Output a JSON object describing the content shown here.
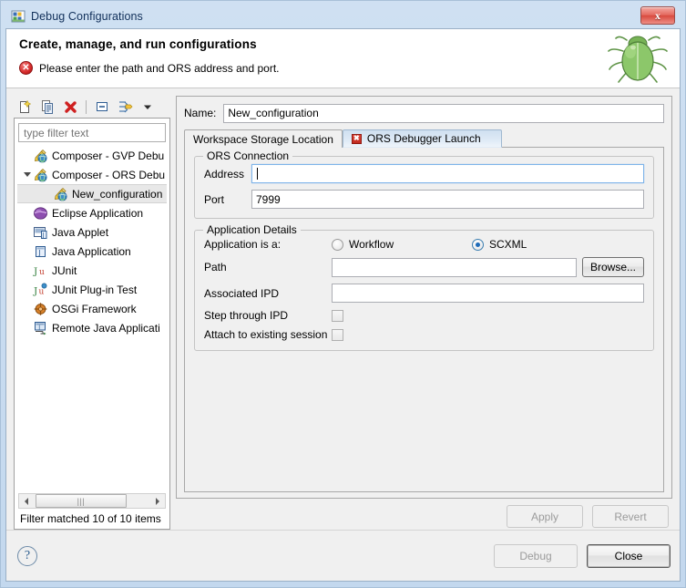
{
  "window": {
    "title": "Debug Configurations",
    "title_icon": "debug-configurations-icon",
    "close_label": "x"
  },
  "banner": {
    "title": "Create, manage, and run configurations",
    "status_icon": "error-icon",
    "status_message": "Please enter the path and ORS address and port.",
    "decoration_icon": "green-bug-icon"
  },
  "tree_toolbar": {
    "buttons": [
      {
        "name": "new-configuration-button",
        "tooltip": "New launch configuration"
      },
      {
        "name": "duplicate-configuration-button",
        "tooltip": "Duplicate"
      },
      {
        "name": "delete-configuration-button",
        "tooltip": "Delete"
      },
      {
        "name": "collapse-all-button",
        "tooltip": "Collapse All"
      },
      {
        "name": "filter-button",
        "tooltip": "Filter launch configurations"
      },
      {
        "name": "view-menu-button",
        "tooltip": "View Menu"
      }
    ]
  },
  "filter": {
    "placeholder": "type filter text",
    "value": "",
    "status": "Filter matched 10 of 10 items"
  },
  "tree": {
    "items": [
      {
        "label": "Composer - GVP Debu",
        "icon": "composer-gvp-icon",
        "indent": 0,
        "arrow": "none",
        "selected": false
      },
      {
        "label": "Composer - ORS Debu",
        "icon": "composer-ors-icon",
        "indent": 0,
        "arrow": "expanded",
        "selected": false
      },
      {
        "label": "New_configuration",
        "icon": "composer-ors-icon",
        "indent": 1,
        "arrow": "none",
        "selected": true
      },
      {
        "label": "Eclipse Application",
        "icon": "eclipse-application-icon",
        "indent": 0,
        "arrow": "none",
        "selected": false
      },
      {
        "label": "Java Applet",
        "icon": "java-applet-icon",
        "indent": 0,
        "arrow": "none",
        "selected": false
      },
      {
        "label": "Java Application",
        "icon": "java-application-icon",
        "indent": 0,
        "arrow": "none",
        "selected": false
      },
      {
        "label": "JUnit",
        "icon": "junit-icon",
        "indent": 0,
        "arrow": "none",
        "selected": false
      },
      {
        "label": "JUnit Plug-in Test",
        "icon": "junit-plugin-test-icon",
        "indent": 0,
        "arrow": "none",
        "selected": false
      },
      {
        "label": "OSGi Framework",
        "icon": "osgi-framework-icon",
        "indent": 0,
        "arrow": "none",
        "selected": false
      },
      {
        "label": "Remote Java Applicati",
        "icon": "remote-java-application-icon",
        "indent": 0,
        "arrow": "none",
        "selected": false
      }
    ]
  },
  "editor": {
    "name_label": "Name:",
    "name_value": "New_configuration",
    "tabs": [
      {
        "label": "Workspace Storage Location",
        "active": false,
        "error": false
      },
      {
        "label": "ORS Debugger Launch",
        "active": true,
        "error": true
      }
    ],
    "ors_connection": {
      "title": "ORS Connection",
      "address_label": "Address",
      "address_value": "",
      "address_focused": true,
      "port_label": "Port",
      "port_value": "7999"
    },
    "application_details": {
      "title": "Application Details",
      "application_is_a_label": "Application is a:",
      "radio_workflow_label": "Workflow",
      "radio_workflow_selected": false,
      "radio_scxml_label": "SCXML",
      "radio_scxml_selected": true,
      "path_label": "Path",
      "path_value": "",
      "browse_label": "Browse...",
      "associated_ipd_label": "Associated IPD",
      "associated_ipd_value": "",
      "step_through_ipd_label": "Step through IPD",
      "step_through_ipd_checked": false,
      "attach_existing_session_label": "Attach to existing session",
      "attach_existing_session_checked": false
    },
    "apply_label": "Apply",
    "apply_enabled": false,
    "revert_label": "Revert",
    "revert_enabled": false
  },
  "footer": {
    "help_label": "?",
    "help_icon": "help-icon",
    "debug_label": "Debug",
    "debug_enabled": false,
    "close_label": "Close",
    "close_enabled": true
  },
  "colors": {
    "window_chrome": "#cfe0f2",
    "client_bg": "#f0f0f0",
    "active_tab": "#dfeaf6",
    "error_red": "#d62b2b",
    "selection_gray": "#e8e8e8",
    "accent_blue": "#1e6bb8"
  }
}
